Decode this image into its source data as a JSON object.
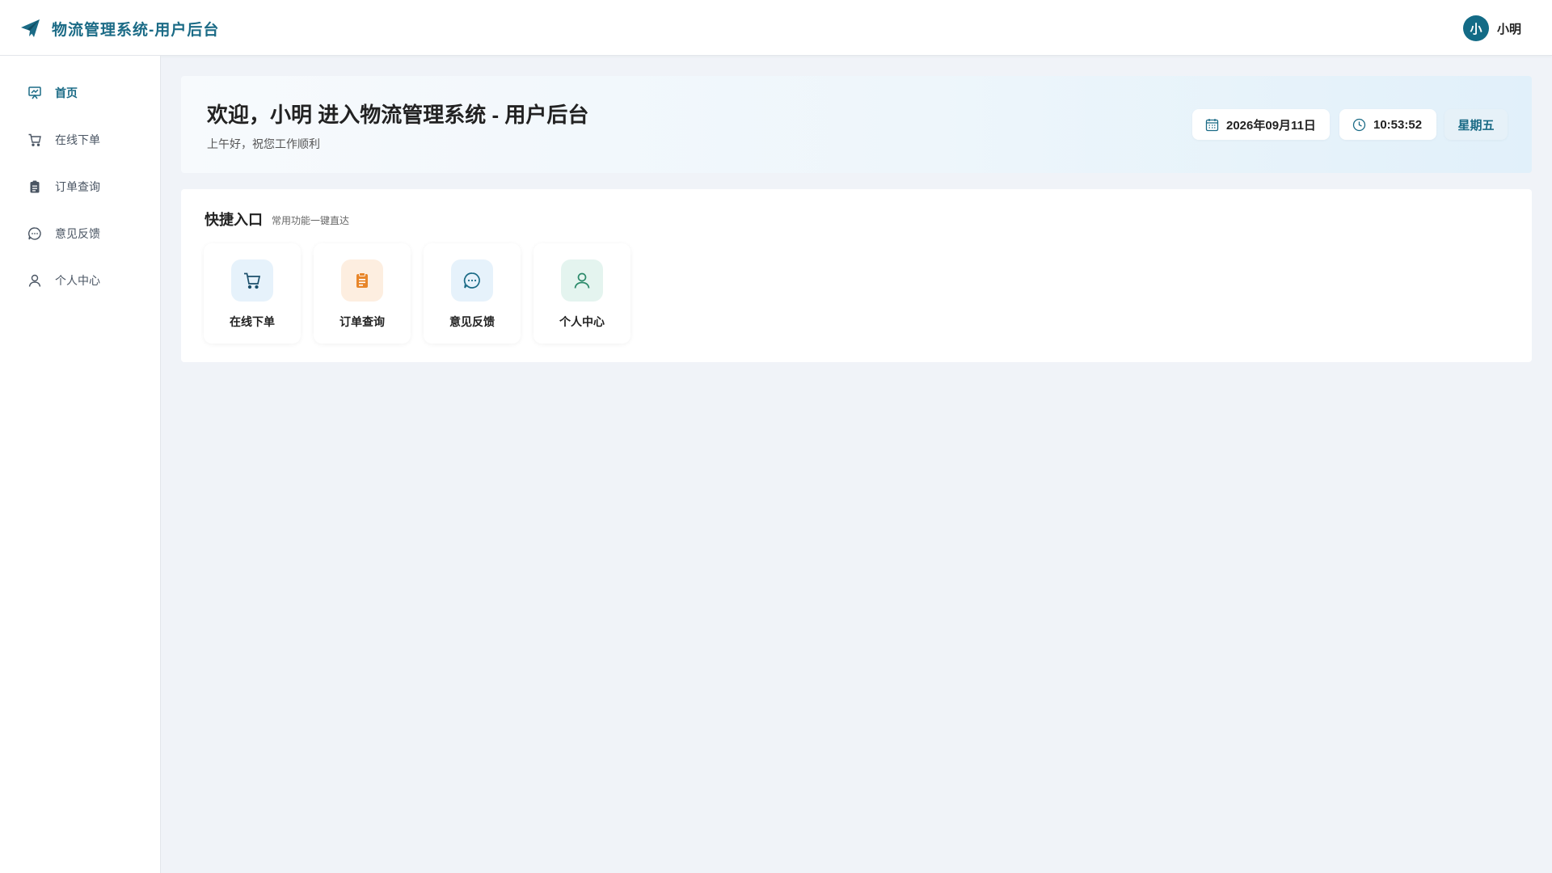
{
  "header": {
    "brand_icon": "paper-plane-icon",
    "title": "物流管理系统-用户后台",
    "user": {
      "avatar_text": "小",
      "name": "小明"
    }
  },
  "sidebar": {
    "items": [
      {
        "label": "首页",
        "icon": "chart-board-icon",
        "active": true
      },
      {
        "label": "在线下单",
        "icon": "cart-icon",
        "active": false
      },
      {
        "label": "订单查询",
        "icon": "clipboard-icon",
        "active": false
      },
      {
        "label": "意见反馈",
        "icon": "chat-bubble-icon",
        "active": false
      },
      {
        "label": "个人中心",
        "icon": "user-icon",
        "active": false
      }
    ]
  },
  "welcome": {
    "title": "欢迎，小明 进入物流管理系统 - 用户后台",
    "subtitle": "上午好，祝您工作顺利",
    "date": "2026年09月11日",
    "time": "10:53:52",
    "weekday": "星期五"
  },
  "quick": {
    "title": "快捷入口",
    "subtitle": "常用功能一键直达",
    "cards": [
      {
        "label": "在线下单",
        "icon": "cart-icon",
        "bg": "#e6f2fb",
        "color": "#1b4f6b"
      },
      {
        "label": "订单查询",
        "icon": "clipboard-icon",
        "bg": "#fdeee0",
        "color": "#e8862a"
      },
      {
        "label": "意见反馈",
        "icon": "chat-bubble-icon",
        "bg": "#e6f2fb",
        "color": "#1b6b86"
      },
      {
        "label": "个人中心",
        "icon": "user-icon",
        "bg": "#e4f4ef",
        "color": "#2b8a6a"
      }
    ]
  },
  "colors": {
    "primary": "#1b6b86",
    "background": "#f0f3f8"
  }
}
